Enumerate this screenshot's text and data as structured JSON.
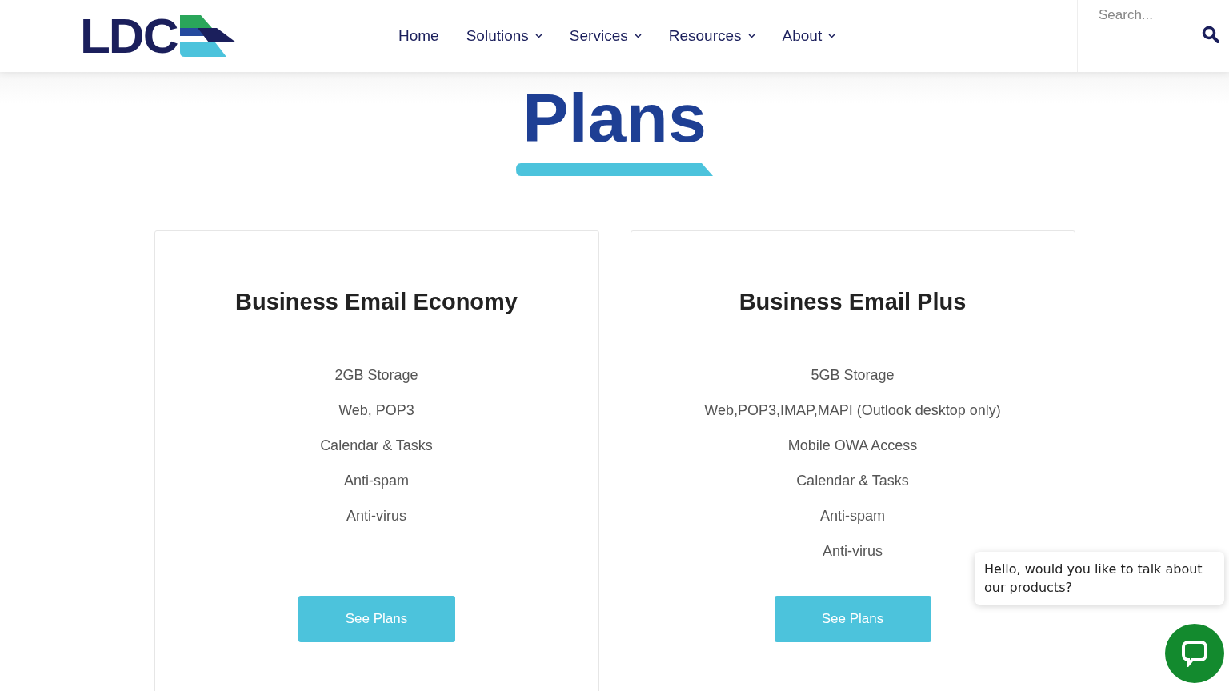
{
  "header": {
    "logo": "LDC",
    "nav": [
      {
        "label": "Home",
        "has_menu": false
      },
      {
        "label": "Solutions",
        "has_menu": true
      },
      {
        "label": "Services",
        "has_menu": true
      },
      {
        "label": "Resources",
        "has_menu": true
      },
      {
        "label": "About",
        "has_menu": true
      }
    ],
    "search": {
      "placeholder": "Search..."
    }
  },
  "page_title": "Plans",
  "plans": [
    {
      "title": "Business Email Economy",
      "features": [
        "2GB Storage",
        "Web, POP3",
        "Calendar & Tasks",
        "Anti-spam",
        "Anti-virus"
      ],
      "button": "See Plans"
    },
    {
      "title": "Business Email Plus",
      "features": [
        "5GB Storage",
        "Web,POP3,IMAP,MAPI (Outlook desktop only)",
        "Mobile OWA Access",
        "Calendar & Tasks",
        "Anti-spam",
        "Anti-virus"
      ],
      "button": "See Plans"
    }
  ],
  "chat": {
    "message": "Hello, would you like to talk about our products?"
  }
}
